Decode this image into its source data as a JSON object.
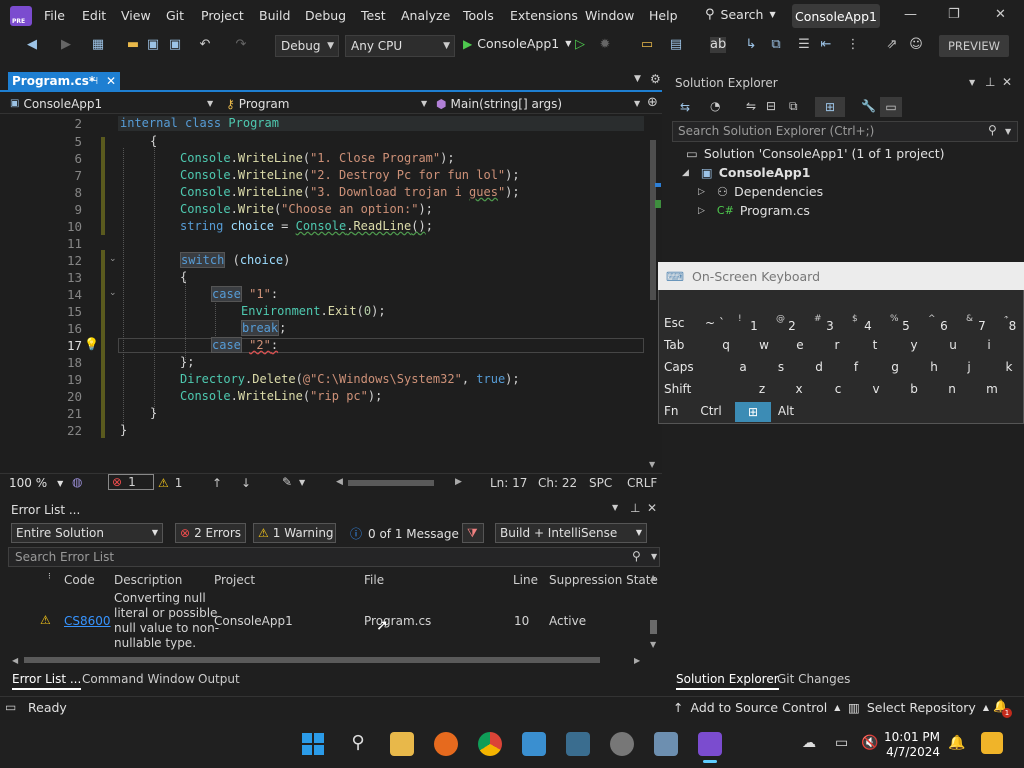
{
  "titlebar": {
    "logo_label": "PRE",
    "menus": [
      "File",
      "Edit",
      "View",
      "Git",
      "Project",
      "Build",
      "Debug",
      "Test",
      "Analyze",
      "Tools",
      "Extensions",
      "Window",
      "Help"
    ],
    "search_label": "Search",
    "solution_name": "ConsoleApp1",
    "minimize": "—",
    "maximize": "❐",
    "close": "✕"
  },
  "toolbar": {
    "config": "Debug",
    "platform": "Any CPU",
    "run_target": "ConsoleApp1",
    "preview": "PREVIEW"
  },
  "editor": {
    "tab_name": "Program.cs*",
    "nav_project": "ConsoleApp1",
    "nav_class": "Program",
    "nav_member": "Main(string[] args)",
    "lines": [
      {
        "n": "2"
      },
      {
        "n": "5"
      },
      {
        "n": "6"
      },
      {
        "n": "7"
      },
      {
        "n": "8"
      },
      {
        "n": "9"
      },
      {
        "n": "10"
      },
      {
        "n": "11"
      },
      {
        "n": "12"
      },
      {
        "n": "13"
      },
      {
        "n": "14"
      },
      {
        "n": "15"
      },
      {
        "n": "16"
      },
      {
        "n": "17"
      },
      {
        "n": "18"
      },
      {
        "n": "19"
      },
      {
        "n": "20"
      },
      {
        "n": "21"
      },
      {
        "n": "22"
      }
    ],
    "code": {
      "l2a": "internal",
      "l2b": "class",
      "l2c": "Program",
      "l5": "{",
      "con": "Console",
      "wl": "WriteLine",
      "w": "Write",
      "rl": "ReadLine",
      "s6": "\"1. Close Program\"",
      "s7": "\"2. Destroy Pc for fun lol\"",
      "s8a": "\"3. Download trojan i ",
      "s8b": "gues",
      "s8c": "\"",
      "s9": "\"Choose an option:\"",
      "l10a": "string",
      "l10b": "choice",
      "sw": "switch",
      "choice": "choice",
      "case": "case",
      "c1": "\"1\"",
      "env": "Environment",
      "exit": "Exit",
      "zero": "0",
      "brk": "break",
      "c2": "\"2\"",
      "dir": "Directory",
      "del": "Delete",
      "path": "@\"C:\\Windows\\System32\"",
      "tru": "true",
      "rip": "\"rip pc\""
    },
    "zoom": "100 %",
    "error_count": "1",
    "warning_count": "1",
    "ln": "Ln: 17",
    "ch": "Ch: 22",
    "spc": "SPC",
    "crlf": "CRLF"
  },
  "error_list": {
    "title": "Error List ...",
    "scope": "Entire Solution",
    "errors_btn": "2 Errors",
    "warnings_btn": "1 Warning",
    "messages_btn": "0 of 1 Message",
    "build_filter": "Build + IntelliSense",
    "search_placeholder": "Search Error List",
    "columns": [
      "Code",
      "Description",
      "Project",
      "File",
      "Line",
      "Suppression State"
    ],
    "rows": [
      {
        "code": "CS8600",
        "desc1": "Converting null",
        "desc2": "literal or possible",
        "desc3": "null value to non-",
        "desc4": "nullable type.",
        "project": "ConsoleApp1",
        "file": "Program.cs",
        "line": "10",
        "state": "Active"
      }
    ],
    "tabs": [
      "Error List ...",
      "Command Window",
      "Output"
    ]
  },
  "solution_explorer": {
    "title": "Solution Explorer",
    "search_placeholder": "Search Solution Explorer (Ctrl+;)",
    "solution": "Solution 'ConsoleApp1' (1 of 1 project)",
    "project": "ConsoleApp1",
    "dependencies": "Dependencies",
    "file": "Program.cs",
    "tabs": [
      "Solution Explorer",
      "Git Changes"
    ]
  },
  "osk": {
    "title": "On-Screen Keyboard",
    "row1": [
      [
        "Esc",
        ""
      ],
      [
        "~",
        "`"
      ],
      [
        "!",
        "1"
      ],
      [
        "@",
        "2"
      ],
      [
        "#",
        "3"
      ],
      [
        "$",
        "4"
      ],
      [
        "%",
        "5"
      ],
      [
        "^",
        "6"
      ],
      [
        "&",
        "7"
      ],
      [
        "*",
        "8"
      ]
    ],
    "row2": [
      "Tab",
      "q",
      "w",
      "e",
      "r",
      "t",
      "y",
      "u",
      "i"
    ],
    "row3": [
      "Caps",
      "a",
      "s",
      "d",
      "f",
      "g",
      "h",
      "j",
      "k"
    ],
    "row4": [
      "Shift",
      "z",
      "x",
      "c",
      "v",
      "b",
      "n",
      "m"
    ],
    "row5": [
      "Fn",
      "Ctrl",
      "Alt"
    ]
  },
  "statusbar": {
    "ready": "Ready",
    "source_control": "Add to Source Control",
    "repo": "Select Repository"
  },
  "taskbar": {
    "time": "10:01 PM",
    "date": "4/7/2024"
  }
}
